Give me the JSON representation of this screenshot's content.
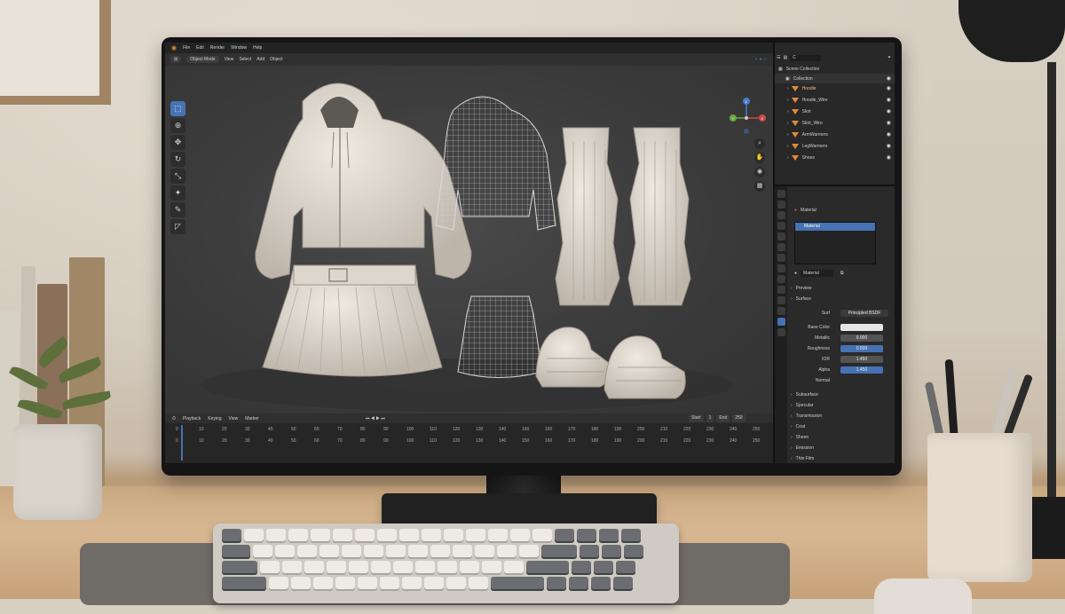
{
  "menu": {
    "items": [
      "File",
      "Edit",
      "Render",
      "Window",
      "Help"
    ]
  },
  "viewport_header": {
    "mode": "Object Mode",
    "view": "View",
    "select": "Select",
    "add": "Add",
    "object": "Object"
  },
  "outliner": {
    "search_value": "C",
    "root": "Scene Collection",
    "collection": "Collection",
    "items": [
      "Hoodie",
      "Hoodie_Wire",
      "Skirt",
      "Skirt_Wire",
      "ArmWarmers",
      "LegWarmers",
      "Shoes"
    ]
  },
  "properties": {
    "tab_title": "Material",
    "slot": "Material",
    "material_name": "Material",
    "panels": {
      "preview": "Preview",
      "surface": "Surface"
    },
    "surface_shader_label": "Surf",
    "surface_shader": "Principled BSDF",
    "fields": [
      {
        "label": "Base Color",
        "value": ""
      },
      {
        "label": "Metallic",
        "value": "0.000"
      },
      {
        "label": "Roughness",
        "value": "0.500"
      },
      {
        "label": "IOR",
        "value": "1.450"
      },
      {
        "label": "Alpha",
        "value": "1.450"
      },
      {
        "label": "Normal",
        "value": ""
      }
    ],
    "subpanels": [
      "Subsurface",
      "Specular",
      "Transmission",
      "Coat",
      "Sheen",
      "Emission",
      "Thin Film"
    ]
  },
  "timeline": {
    "menus": [
      "Playback",
      "Keying",
      "View",
      "Marker"
    ],
    "start_label": "Start",
    "start_value": "1",
    "end_label": "End",
    "end_value": "250",
    "ruler_top": [
      "0",
      "10",
      "20",
      "30",
      "40",
      "50",
      "60",
      "70",
      "80",
      "90",
      "100",
      "110",
      "120",
      "130",
      "140",
      "150",
      "160",
      "170",
      "180",
      "190",
      "200",
      "210",
      "220",
      "230",
      "240",
      "250"
    ],
    "ruler_bottom": [
      "0",
      "10",
      "20",
      "30",
      "40",
      "50",
      "60",
      "70",
      "80",
      "90",
      "100",
      "110",
      "120",
      "130",
      "140",
      "150",
      "160",
      "170",
      "180",
      "190",
      "200",
      "210",
      "220",
      "230",
      "240",
      "250"
    ]
  },
  "gizmo": {
    "z": "Z",
    "y": "Y",
    "x": "X"
  },
  "colors": {
    "accent": "#4772b3",
    "object_orange": "#e08a3a",
    "garment": "#e9e2d8"
  }
}
